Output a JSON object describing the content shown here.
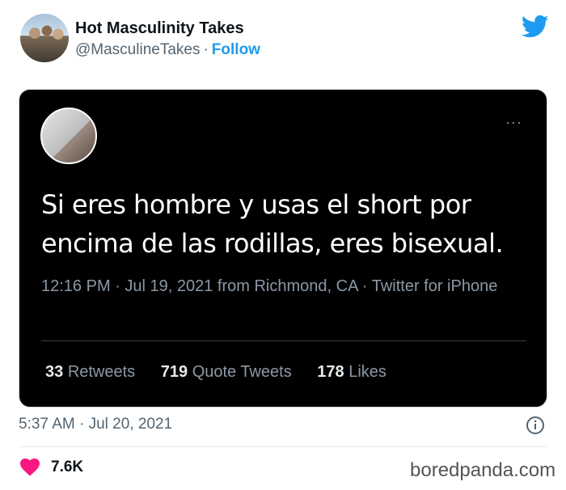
{
  "header": {
    "display_name": "Hot Masculinity Takes",
    "handle": "@MasculineTakes",
    "separator": "·",
    "follow_label": "Follow"
  },
  "embedded_tweet": {
    "text": "Si eres hombre y usas el short por encima de las rodillas, eres bisexual.",
    "meta": "12:16 PM · Jul 19, 2021 from Richmond, CA · Twitter for iPhone",
    "more_label": "···",
    "stats": [
      {
        "count": "33",
        "label": "Retweets"
      },
      {
        "count": "719",
        "label": "Quote Tweets"
      },
      {
        "count": "178",
        "label": "Likes"
      }
    ]
  },
  "footer": {
    "timestamp": "5:37 AM · Jul 20, 2021",
    "likes": "7.6K"
  },
  "watermark": "boredpanda.com",
  "colors": {
    "accent": "#1d9bf0",
    "heart": "#f91880",
    "card_bg": "#000000"
  },
  "icons": [
    "twitter-bird-icon",
    "more-icon",
    "info-icon",
    "heart-icon"
  ]
}
